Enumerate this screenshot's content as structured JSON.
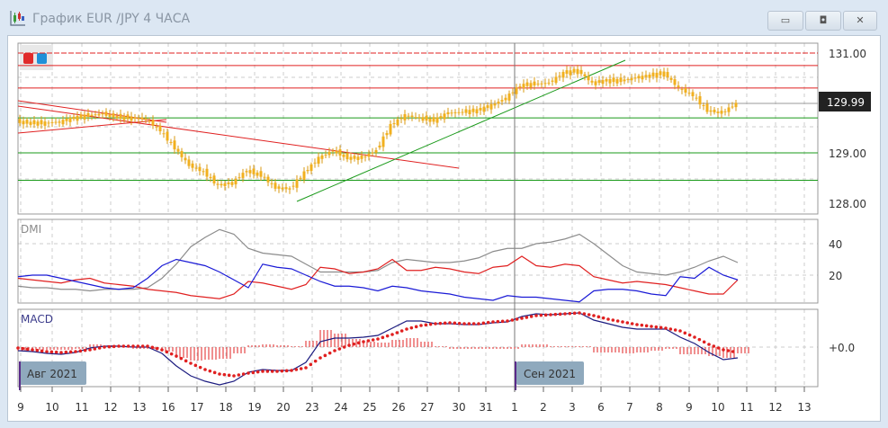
{
  "window": {
    "title": "График EUR /JPY  4 ЧАСА",
    "minimize": "minimize",
    "maximize": "maximize",
    "close": "close"
  },
  "colors": {
    "candle": "#f2b01e",
    "plus_di": "#1a1ad6",
    "minus_di": "#e02020",
    "adx": "#8c8c8c",
    "macd": "#1c1c80",
    "signal": "#e02020",
    "support": "#1a9a1a",
    "resistance": "#e02020"
  },
  "price_axis": {
    "labels": [
      "131.00",
      "129.00",
      "128.00"
    ],
    "current_price": "129.99"
  },
  "dmi": {
    "title": "DMI",
    "labels": [
      "40",
      "20"
    ]
  },
  "macd": {
    "title": "MACD",
    "labels": [
      "+0.0"
    ]
  },
  "months": [
    "Авг 2021",
    "Сен 2021"
  ],
  "x_labels": [
    "9",
    "10",
    "11",
    "12",
    "13",
    "16",
    "17",
    "18",
    "19",
    "20",
    "23",
    "24",
    "25",
    "26",
    "27",
    "30",
    "31",
    "1",
    "2",
    "3",
    "6",
    "7",
    "8",
    "9",
    "10",
    "11",
    "12",
    "13"
  ],
  "chart_data": {
    "type": "line",
    "price_close": [
      129.63,
      129.6,
      129.6,
      129.62,
      129.7,
      129.75,
      129.78,
      129.72,
      129.7,
      129.68,
      129.45,
      129.1,
      128.75,
      128.62,
      128.35,
      128.4,
      128.65,
      128.55,
      128.3,
      128.28,
      128.6,
      128.9,
      129.05,
      128.9,
      128.9,
      129.05,
      129.55,
      129.75,
      129.7,
      129.65,
      129.8,
      129.82,
      129.85,
      129.95,
      130.1,
      130.35,
      130.38,
      130.4,
      130.6,
      130.65,
      130.4,
      130.45,
      130.45,
      130.5,
      130.55,
      130.6,
      130.3,
      130.15,
      129.85,
      129.8,
      129.99
    ],
    "price_levels": {
      "resistance": [
        131.0,
        130.75,
        130.3
      ],
      "current": 129.99,
      "support": [
        129.7,
        129.0,
        128.45
      ]
    },
    "adx": [
      13,
      12,
      12,
      11,
      11,
      10,
      11,
      11,
      11,
      12,
      18,
      27,
      38,
      44,
      49,
      46,
      37,
      34,
      33,
      32,
      27,
      22,
      22,
      22,
      22,
      23,
      28,
      30,
      29,
      28,
      28,
      29,
      31,
      35,
      37,
      37,
      40,
      41,
      43,
      46,
      40,
      33,
      26,
      22,
      21,
      20,
      22,
      25,
      29,
      32,
      28
    ],
    "plus_di": [
      19,
      20,
      20,
      18,
      16,
      14,
      12,
      11,
      12,
      18,
      26,
      30,
      28,
      26,
      22,
      17,
      12,
      27,
      25,
      24,
      20,
      16,
      13,
      13,
      12,
      10,
      13,
      12,
      10,
      9,
      8,
      6,
      5,
      4,
      7,
      6,
      6,
      5,
      4,
      3,
      10,
      11,
      11,
      10,
      8,
      7,
      19,
      18,
      25,
      20,
      17
    ],
    "minus_di": [
      18,
      17,
      16,
      15,
      17,
      18,
      15,
      14,
      13,
      11,
      10,
      9,
      7,
      6,
      5,
      8,
      16,
      15,
      13,
      11,
      14,
      25,
      24,
      21,
      22,
      24,
      30,
      23,
      23,
      25,
      24,
      22,
      21,
      25,
      26,
      32,
      26,
      25,
      27,
      26,
      19,
      17,
      15,
      16,
      15,
      14,
      12,
      10,
      8,
      8,
      17
    ],
    "macd": [
      -0.04,
      -0.05,
      -0.07,
      -0.08,
      -0.06,
      -0.01,
      0.01,
      0.01,
      0,
      0,
      -0.07,
      -0.21,
      -0.32,
      -0.38,
      -0.42,
      -0.38,
      -0.28,
      -0.25,
      -0.26,
      -0.26,
      -0.17,
      0.06,
      0.1,
      0.1,
      0.11,
      0.13,
      0.21,
      0.29,
      0.29,
      0.26,
      0.26,
      0.25,
      0.25,
      0.27,
      0.28,
      0.34,
      0.37,
      0.36,
      0.37,
      0.38,
      0.3,
      0.26,
      0.22,
      0.2,
      0.2,
      0.2,
      0.11,
      0.04,
      -0.06,
      -0.14,
      -0.12
    ],
    "signal": [
      -0.01,
      -0.03,
      -0.05,
      -0.06,
      -0.05,
      -0.03,
      0,
      0.01,
      0.01,
      0.01,
      -0.03,
      -0.1,
      -0.18,
      -0.25,
      -0.3,
      -0.32,
      -0.29,
      -0.27,
      -0.27,
      -0.26,
      -0.23,
      -0.12,
      -0.04,
      0.02,
      0.06,
      0.09,
      0.14,
      0.2,
      0.24,
      0.26,
      0.27,
      0.26,
      0.26,
      0.28,
      0.29,
      0.32,
      0.35,
      0.36,
      0.37,
      0.38,
      0.35,
      0.31,
      0.28,
      0.25,
      0.23,
      0.21,
      0.18,
      0.11,
      0.03,
      -0.03,
      -0.06
    ]
  }
}
